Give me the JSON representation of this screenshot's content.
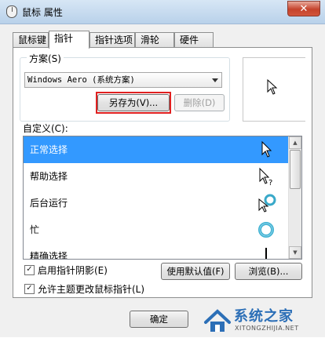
{
  "window": {
    "title": "鼠标 属性",
    "close_label": "✕"
  },
  "tabs": [
    {
      "label": "鼠标键"
    },
    {
      "label": "指针",
      "active": true
    },
    {
      "label": "指针选项"
    },
    {
      "label": "滑轮"
    },
    {
      "label": "硬件"
    }
  ],
  "scheme": {
    "label": "方案(S)",
    "selected": "Windows Aero (系统方案)",
    "save_as_label": "另存为(V)...",
    "delete_label": "删除(D)"
  },
  "custom": {
    "label": "自定义(C):",
    "items": [
      {
        "label": "正常选择",
        "icon": "arrow-cursor-icon",
        "selected": true
      },
      {
        "label": "帮助选择",
        "icon": "help-cursor-icon"
      },
      {
        "label": "后台运行",
        "icon": "working-in-background-cursor-icon"
      },
      {
        "label": "忙",
        "icon": "busy-cursor-icon"
      },
      {
        "label": "精确选择",
        "icon": "precision-cursor-icon"
      }
    ]
  },
  "options": {
    "shadow_label": "启用指针阴影(E)",
    "shadow_checked": true,
    "theme_label": "允许主题更改鼠标指针(L)",
    "theme_checked": true,
    "use_default_label": "使用默认值(F)",
    "browse_label": "浏览(B)..."
  },
  "footer": {
    "ok_label": "确定"
  },
  "watermark": {
    "text": "系统之家",
    "url": "XITONGZHIJIA.NET"
  },
  "colors": {
    "selection": "#3399ff",
    "highlight_box": "#e02020",
    "watermark": "#2c6fb7"
  }
}
